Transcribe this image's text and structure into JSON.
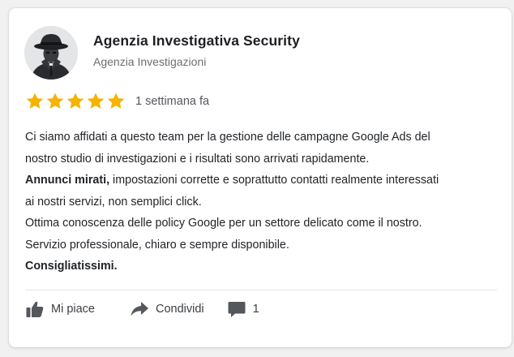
{
  "review": {
    "author_name": "Agenzia Investigativa Security",
    "author_subtitle": "Agenzia Investigazioni",
    "rating": 5,
    "rating_max": 5,
    "time_ago": "1 settimana fa",
    "star_color": "#f4b400",
    "body": {
      "line1": "Ci siamo affidati a questo team per la gestione delle campagne Google Ads del",
      "line2": "nostro studio di investigazioni e i risultati sono arrivati rapidamente.",
      "line3_bold": "Annunci mirati,",
      "line3_rest": " impostazioni corrette e soprattutto contatti realmente interessati",
      "line4": "ai nostri servizi, non semplici click.",
      "line5": "Ottima conoscenza delle policy Google per un settore delicato come il nostro.",
      "line6": "Servizio professionale, chiaro e sempre disponibile.",
      "line7_bold": "Consigliatissimi."
    }
  },
  "actions": {
    "like_label": "Mi piace",
    "share_label": "Condividi",
    "comment_count": "1",
    "icons": [
      "thumbs-up-icon",
      "share-arrow-icon",
      "comment-icon"
    ]
  }
}
